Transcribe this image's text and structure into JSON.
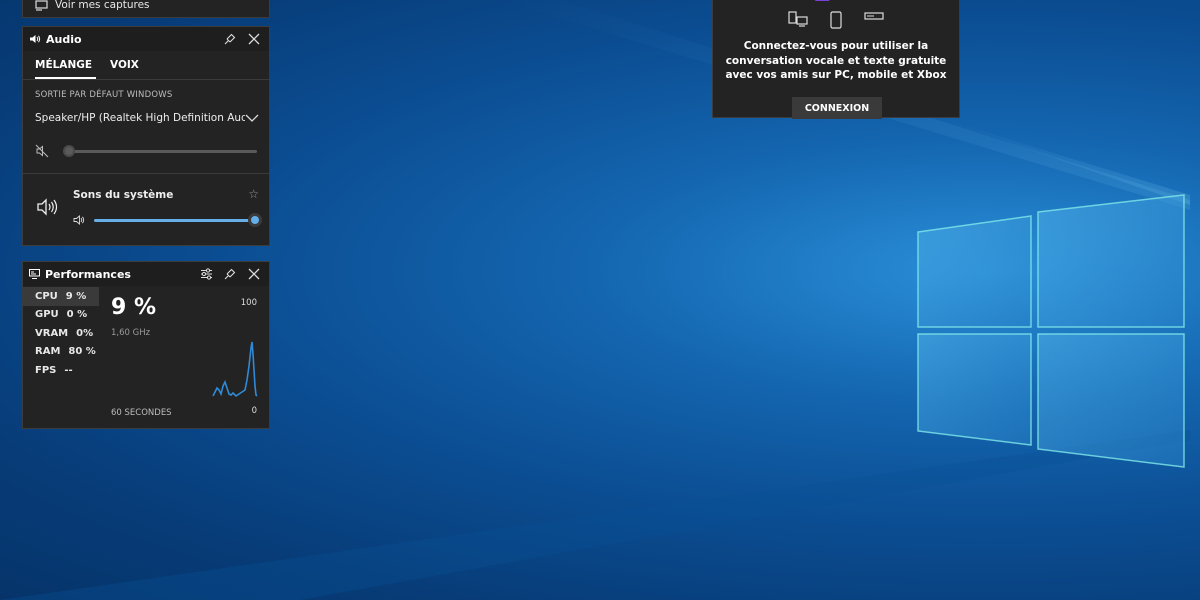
{
  "captures": {
    "label": "Voir mes captures"
  },
  "audio": {
    "title": "Audio",
    "tabs": [
      "MÉLANGE",
      "VOIX"
    ],
    "default_output_label": "SORTIE PAR DÉFAUT WINDOWS",
    "device": "Speaker/HP (Realtek High Definition Aud...",
    "master_volume": 0,
    "app_name": "Sons du système",
    "app_volume": 0.99
  },
  "performances": {
    "title": "Performances",
    "stats": [
      {
        "name": "CPU",
        "value": "9 %"
      },
      {
        "name": "GPU",
        "value": "0 %"
      },
      {
        "name": "VRAM",
        "value": "0%"
      },
      {
        "name": "RAM",
        "value": "80 %"
      },
      {
        "name": "FPS",
        "value": "--"
      }
    ],
    "big_value": "9 %",
    "frequency": "1,60 GHz",
    "axis_max": "100",
    "axis_min": "0",
    "time_window": "60 SECONDES"
  },
  "social": {
    "message": "Connectez-vous pour utiliser la conversation vocale et texte gratuite avec vos amis sur PC, mobile et Xbox",
    "connect_label": "CONNEXION",
    "device_icons": [
      "pc-icon",
      "mobile-icon",
      "console-icon"
    ]
  },
  "colors": {
    "accent": "#66aee8",
    "panel": "#232323",
    "graph": "#2f8ad8"
  }
}
